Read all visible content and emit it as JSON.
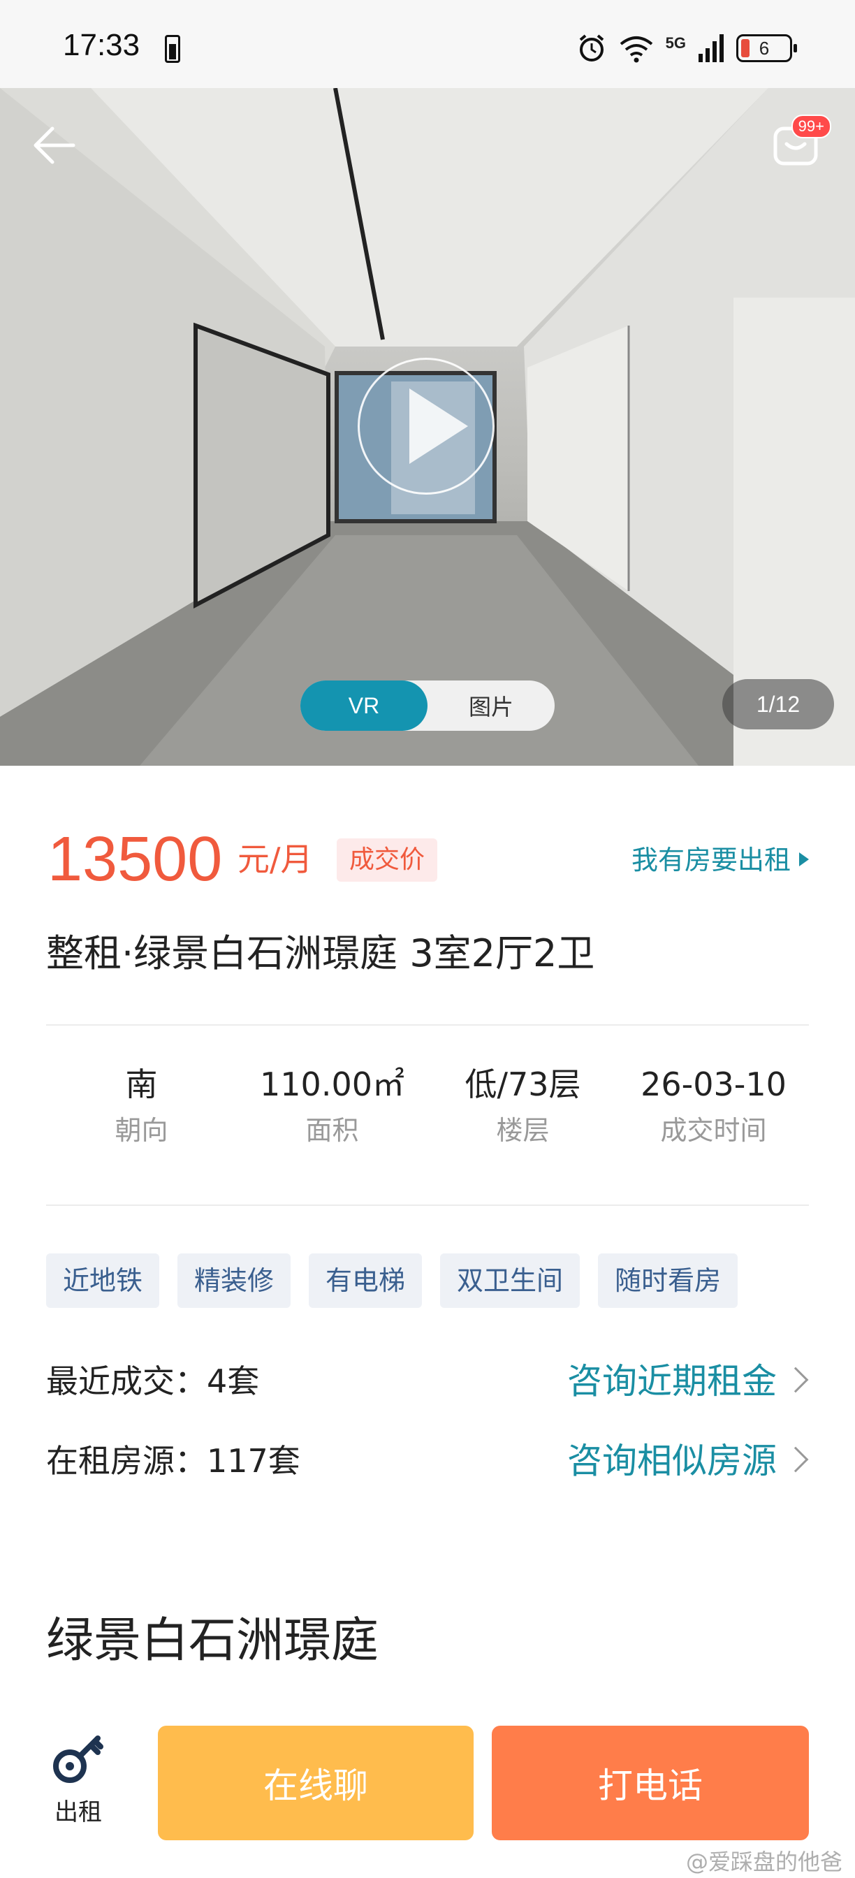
{
  "status_bar": {
    "time": "17:33",
    "network": "5G",
    "battery": "6"
  },
  "hero": {
    "toggle_vr": "VR",
    "toggle_photo": "图片",
    "counter": "1/12",
    "message_badge": "99+",
    "accent": "#1494b0"
  },
  "listing": {
    "price": "13500",
    "price_unit": "元/月",
    "price_badge": "成交价",
    "rent_out_link": "我有房要出租",
    "title": "整租·绿景白石洲璟庭 3室2厅2卫",
    "price_color": "#f05a3d"
  },
  "stats": [
    {
      "value": "南",
      "label": "朝向"
    },
    {
      "value": "110.00㎡",
      "label": "面积"
    },
    {
      "value": "低/73层",
      "label": "楼层"
    },
    {
      "value": "26-03-10",
      "label": "成交时间"
    }
  ],
  "tags": [
    "近地铁",
    "精装修",
    "有电梯",
    "双卫生间",
    "随时看房"
  ],
  "recent_deals": {
    "text": "最近成交：4套",
    "link": "咨询近期租金"
  },
  "available": {
    "text": "在租房源：117套",
    "link": "咨询相似房源"
  },
  "community": {
    "title": "绿景白石洲璟庭"
  },
  "bottom_bar": {
    "rent_label": "出租",
    "chat_label": "在线聊",
    "call_label": "打电话",
    "chat_color": "#ffbc4d",
    "call_color": "#ff7d4a"
  },
  "watermark": "@爱踩盘的他爸"
}
